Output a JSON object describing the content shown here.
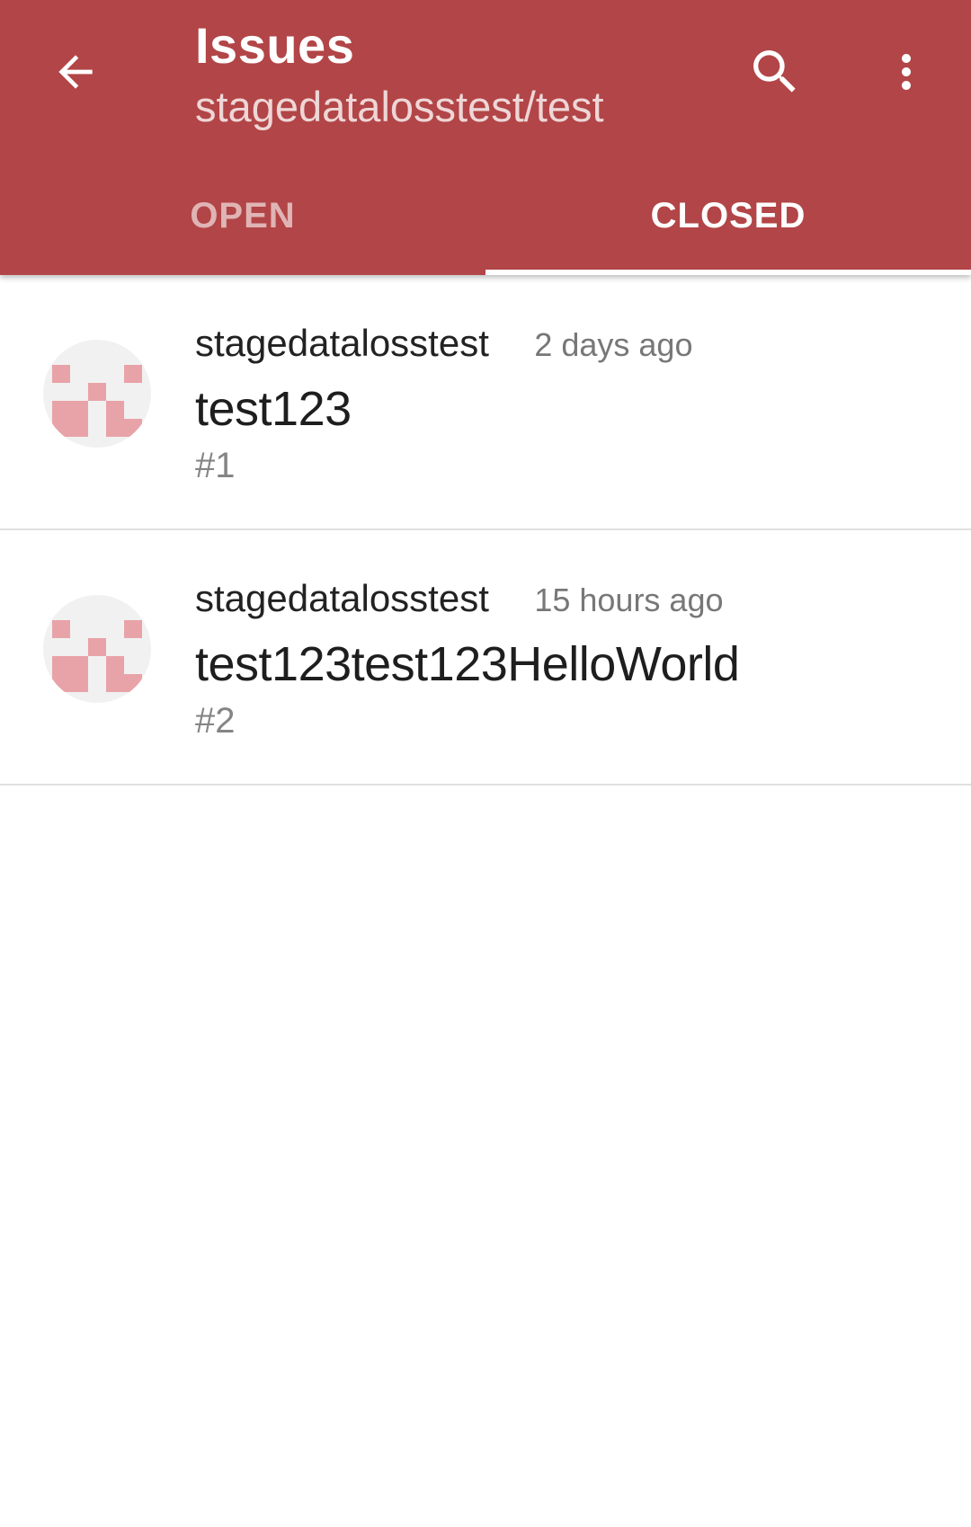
{
  "colors": {
    "appbar": "#b24547",
    "avatar_block": "#e8a3a8",
    "avatar_bg": "#f1f1f1"
  },
  "header": {
    "title": "Issues",
    "subtitle": "stagedatalosstest/test",
    "icons": {
      "back": "arrow-back-icon",
      "search": "search-icon",
      "more": "more-vert-icon"
    }
  },
  "tabs": [
    {
      "label": "OPEN",
      "selected": false
    },
    {
      "label": "CLOSED",
      "selected": true
    }
  ],
  "issues": [
    {
      "author": "stagedatalosstest",
      "time": "2 days ago",
      "title": "test123",
      "number": "#1"
    },
    {
      "author": "stagedatalosstest",
      "time": "15 hours ago",
      "title": "test123test123HelloWorld",
      "number": "#2"
    }
  ]
}
